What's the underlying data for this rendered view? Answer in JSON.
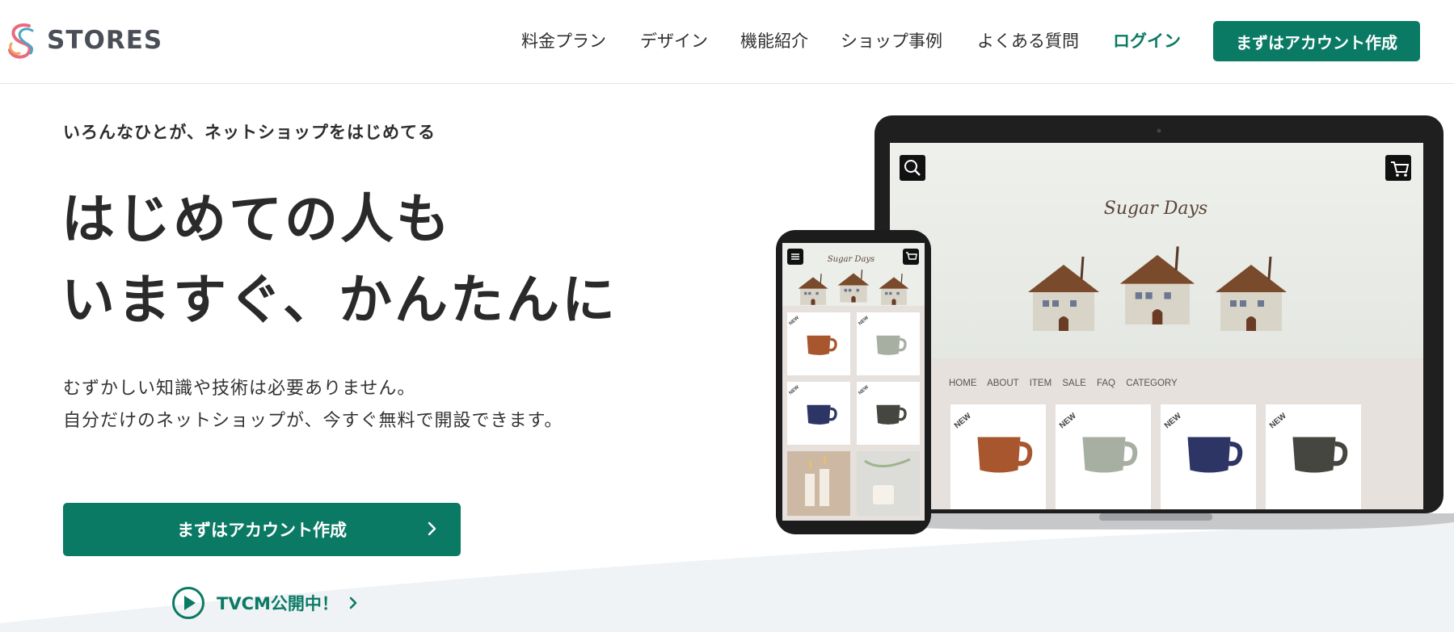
{
  "brand": {
    "name": "STORES"
  },
  "nav": {
    "items": [
      "料金プラン",
      "デザイン",
      "機能紹介",
      "ショップ事例",
      "よくある質問"
    ],
    "login": "ログイン",
    "cta": "まずはアカウント作成"
  },
  "hero": {
    "eyebrow": "いろんなひとが、ネットショップをはじめてる",
    "headline": [
      "はじめての人も",
      "いますぐ、かんたんに"
    ],
    "description": [
      "むずかしい知識や技術は必要ありません。",
      "自分だけのネットショップが、今すぐ無料で開設できます。"
    ],
    "cta": "まずはアカウント作成",
    "tvcm": "TVCM公開中！"
  },
  "mockup": {
    "shop_name": "Sugar Days",
    "menu": [
      "HOME",
      "ABOUT",
      "ITEM",
      "SALE",
      "FAQ",
      "CATEGORY"
    ],
    "badge": "NEW"
  },
  "colors": {
    "accent": "#0b7a64",
    "text": "#2a2a2a",
    "wave": "#eff3f6"
  },
  "icons": [
    "logo-mark-icon",
    "chevron-right-icon",
    "play-icon",
    "search-icon",
    "cart-icon",
    "menu-icon"
  ]
}
